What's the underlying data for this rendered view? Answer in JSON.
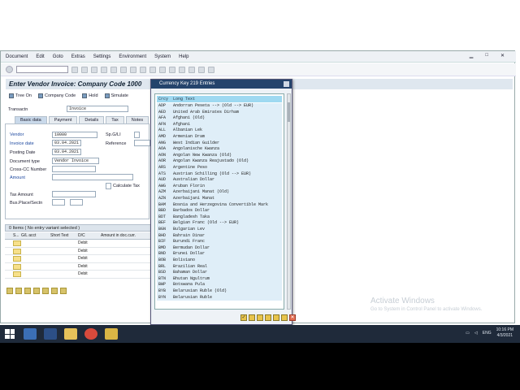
{
  "menu": [
    "Document",
    "Edit",
    "Goto",
    "Extras",
    "Settings",
    "Environment",
    "System",
    "Help"
  ],
  "screen_title": "Enter Vendor Invoice: Company Code 1000",
  "app_toolbar": [
    "Tree On",
    "Company Code",
    "Hold",
    "Simulate"
  ],
  "transaction": {
    "label": "Transactn",
    "value": "Invoice"
  },
  "tabs": [
    "Basic data",
    "Payment",
    "Details",
    "Tax",
    "Notes"
  ],
  "form": {
    "vendor_label": "Vendor",
    "vendor_value": "10000",
    "spgl_label": "Sp.G/LI",
    "invoice_date_label": "Invoice date",
    "invoice_date_value": "03.04.2021",
    "reference_label": "Reference",
    "posting_date_label": "Posting Date",
    "posting_date_value": "03.04.2021",
    "doc_type_label": "Document type",
    "doc_type_value": "Vendor Invoice",
    "cross_cc_label": "Cross-CC Number",
    "amount_label": "Amount",
    "calc_tax_label": "Calculate Tax",
    "tax_amount_label": "Tax Amount",
    "bus_place_label": "Bus.Place/Sectn"
  },
  "items_bar": "0 Items ( No entry variant selected )",
  "grid": {
    "headers": [
      "S...",
      "G/L acct",
      "Short Text",
      "D/C",
      "Amount in doc.curr."
    ],
    "rows": [
      "Debit",
      "Debit",
      "Debit",
      "Debit",
      "Debit"
    ]
  },
  "dialog": {
    "title": "Currency Key 219 Entries",
    "col_crcy": "Crcy",
    "col_long": "Long Text",
    "rows": [
      {
        "c": "ADP",
        "t": "Andorran Peseta --> (Old --> EUR)"
      },
      {
        "c": "AED",
        "t": "United Arab Emirates Dirham"
      },
      {
        "c": "AFA",
        "t": "Afghani (Old)"
      },
      {
        "c": "AFN",
        "t": "Afghani"
      },
      {
        "c": "ALL",
        "t": "Albanian Lek"
      },
      {
        "c": "AMD",
        "t": "Armenian Dram"
      },
      {
        "c": "ANG",
        "t": "West Indian Guilder"
      },
      {
        "c": "AOA",
        "t": "Angolanische Kwanza"
      },
      {
        "c": "AON",
        "t": "Angolan New Kwanza (Old)"
      },
      {
        "c": "AOR",
        "t": "Angolan Kwanza Reajustado (Old)"
      },
      {
        "c": "ARS",
        "t": "Argentine Peso"
      },
      {
        "c": "ATS",
        "t": "Austrian Schilling (Old --> EUR)"
      },
      {
        "c": "AUD",
        "t": "Australian Dollar"
      },
      {
        "c": "AWG",
        "t": "Aruban Florin"
      },
      {
        "c": "AZM",
        "t": "Azerbaijani Manat (Old)"
      },
      {
        "c": "AZN",
        "t": "Azerbaijani Manat"
      },
      {
        "c": "BAM",
        "t": "Bosnia and Herzegovina Convertible Mark"
      },
      {
        "c": "BBD",
        "t": "Barbados Dollar"
      },
      {
        "c": "BDT",
        "t": "Bangladesh Taka"
      },
      {
        "c": "BEF",
        "t": "Belgian Franc (Old --> EUR)"
      },
      {
        "c": "BGN",
        "t": "Bulgarian Lev"
      },
      {
        "c": "BHD",
        "t": "Bahrain Dinar"
      },
      {
        "c": "BIF",
        "t": "Burundi Franc"
      },
      {
        "c": "BMD",
        "t": "Bermudan Dollar"
      },
      {
        "c": "BND",
        "t": "Brunei Dollar"
      },
      {
        "c": "BOB",
        "t": "Boliviano"
      },
      {
        "c": "BRL",
        "t": "Brazilian Real"
      },
      {
        "c": "BSD",
        "t": "Bahaman Dollar"
      },
      {
        "c": "BTN",
        "t": "Bhutan Ngultrum"
      },
      {
        "c": "BWP",
        "t": "Botswana Pula"
      },
      {
        "c": "BYB",
        "t": "Belarusian Ruble (Old)"
      },
      {
        "c": "BYN",
        "t": "Belarusian Ruble"
      }
    ]
  },
  "watermark": {
    "line1": "Activate Windows",
    "line2": "Go to System in Control Panel to activate Windows."
  },
  "tray": {
    "lang": "ENG",
    "time": "10:16 PM",
    "date": "4/3/2021"
  },
  "colors": {
    "dialog_title": "#24446c",
    "dialog_header": "#9fd9f1",
    "taskbar": "#1f2a3a"
  }
}
